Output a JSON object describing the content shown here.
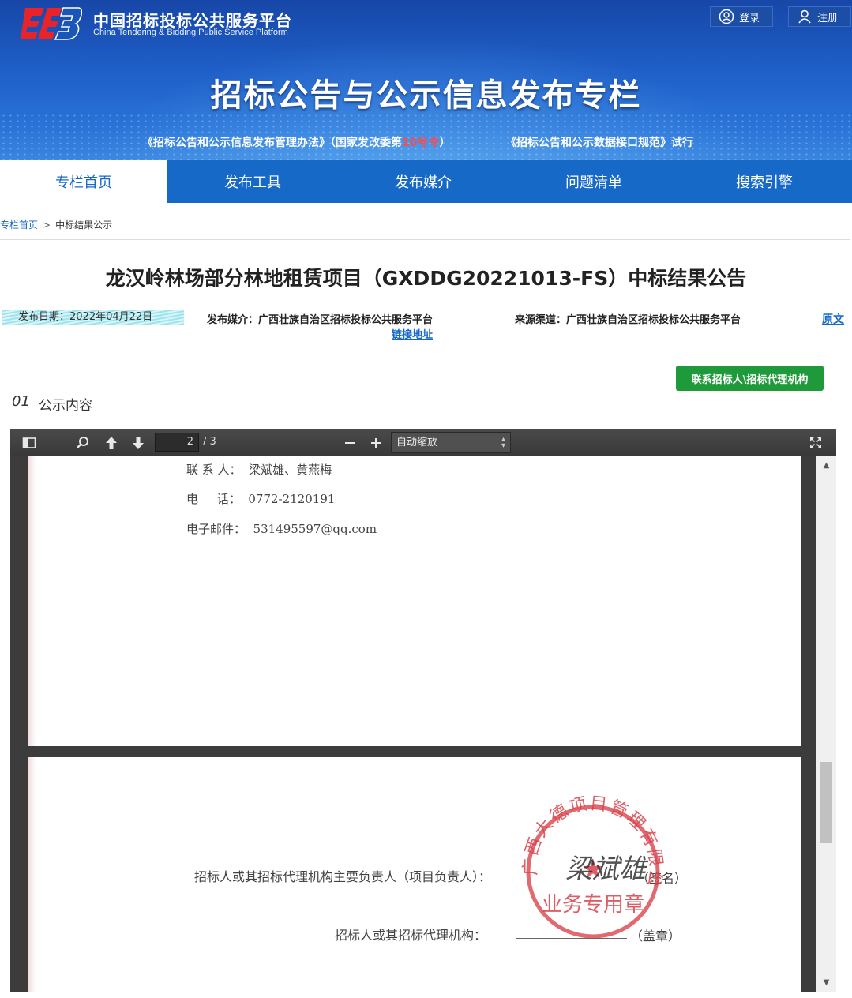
{
  "header": {
    "site_name": "中国招标投标公共服务平台",
    "site_name_en": "China Tendering & Bidding Public Service Platform",
    "login_label": "登录",
    "register_label": "注册",
    "banner_title": "招标公告与公示信息发布专栏",
    "sub_link_1_pre": "《招标公告和公示信息发布管理办法》（国家发改委第",
    "sub_link_1_red": "10号令",
    "sub_link_1_post": "）",
    "sub_link_2": "《招标公告和公示数据接口规范》试行"
  },
  "nav": {
    "items": [
      "专栏首页",
      "发布工具",
      "发布媒介",
      "问题清单",
      "搜索引擎"
    ],
    "active_index": 0
  },
  "breadcrumb": {
    "home": "专栏首页",
    "separator": ">",
    "current": "中标结果公示"
  },
  "article": {
    "title": "龙汉岭林场部分林地租赁项目（GXDDG20221013-FS）中标结果公告",
    "publish_date": "发布日期：2022年04月22日",
    "media": "发布媒介：广西壮族自治区招标投标公共服务平台",
    "link_address": "链接地址",
    "source": "来源渠道：广西壮族自治区招标投标公共服务平台",
    "original": "原文",
    "contact_button": "联系招标人\\招标代理机构",
    "section_number": "01",
    "section_label": "公示内容"
  },
  "pdf_viewer": {
    "current_page": "2",
    "total_pages": "/ 3",
    "zoom": "自动缩放",
    "page1_lines": [
      "联 系 人：  梁斌雄、黄燕梅",
      "电     话：  0772-2120191",
      "电子邮件：  531495597@qq.com"
    ],
    "page2_lines": [
      "招标人或其招标代理机构主要负责人（项目负责人）：",
      "（签名）",
      "招标人或其招标代理机构：",
      "（盖章）"
    ],
    "seal_text": "广西大德项目管理有限公司",
    "seal_sub": "业务专用章",
    "signature": "梁斌雄"
  },
  "colors": {
    "brand_blue": "#1769c7",
    "contact_green": "#1f9a3a",
    "seal_red": "#d9434c"
  }
}
